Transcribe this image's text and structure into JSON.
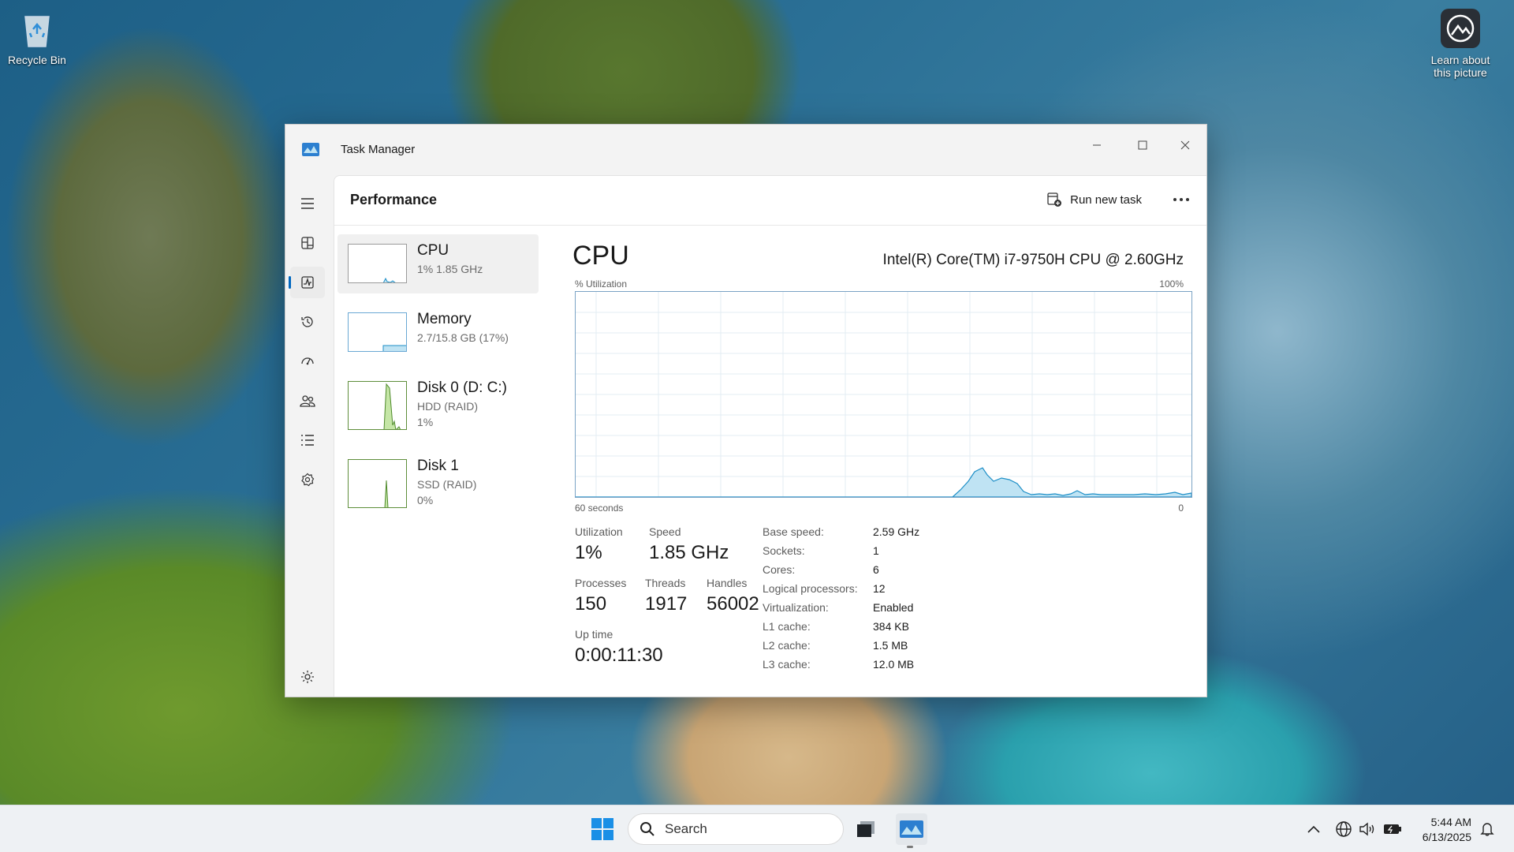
{
  "desktop": {
    "recycle_bin_label": "Recycle Bin",
    "learn_label_line1": "Learn about",
    "learn_label_line2": "this picture"
  },
  "window": {
    "title": "Task Manager",
    "page_title": "Performance",
    "run_new_task": "Run new task"
  },
  "nav": [
    "menu-icon",
    "processes-icon",
    "performance-icon",
    "app-history-icon",
    "startup-apps-icon",
    "users-icon",
    "details-icon",
    "services-icon",
    "settings-icon"
  ],
  "devices": [
    {
      "name": "CPU",
      "line1": "1%  1.85 GHz",
      "line2": ""
    },
    {
      "name": "Memory",
      "line1": "2.7/15.8 GB (17%)",
      "line2": ""
    },
    {
      "name": "Disk 0 (D: C:)",
      "line1": "HDD (RAID)",
      "line2": "1%"
    },
    {
      "name": "Disk 1",
      "line1": "SSD (RAID)",
      "line2": "0%"
    }
  ],
  "cpu": {
    "title": "CPU",
    "model": "Intel(R) Core(TM) i7-9750H CPU @ 2.60GHz",
    "graph_label": "% Utilization",
    "graph_max": "100%",
    "graph_time": "60 seconds",
    "graph_min": "0",
    "utilization_label": "Utilization",
    "utilization": "1%",
    "speed_label": "Speed",
    "speed": "1.85 GHz",
    "processes_label": "Processes",
    "processes": "150",
    "threads_label": "Threads",
    "threads": "1917",
    "handles_label": "Handles",
    "handles": "56002",
    "uptime_label": "Up time",
    "uptime": "0:00:11:30",
    "specs": [
      {
        "k": "Base speed:",
        "v": "2.59 GHz"
      },
      {
        "k": "Sockets:",
        "v": "1"
      },
      {
        "k": "Cores:",
        "v": "6"
      },
      {
        "k": "Logical processors:",
        "v": "12"
      },
      {
        "k": "Virtualization:",
        "v": "Enabled"
      },
      {
        "k": "L1 cache:",
        "v": "384 KB"
      },
      {
        "k": "L2 cache:",
        "v": "1.5 MB"
      },
      {
        "k": "L3 cache:",
        "v": "12.0 MB"
      }
    ]
  },
  "taskbar": {
    "search_placeholder": "Search",
    "time": "5:44 AM",
    "date": "6/13/2025"
  },
  "colors": {
    "accent": "#0067c0",
    "cpu_line": "#1e8fc7",
    "cpu_fill": "#bfe3f3",
    "disk_line": "#4e8a2a",
    "disk_fill": "#c5e6a6"
  }
}
